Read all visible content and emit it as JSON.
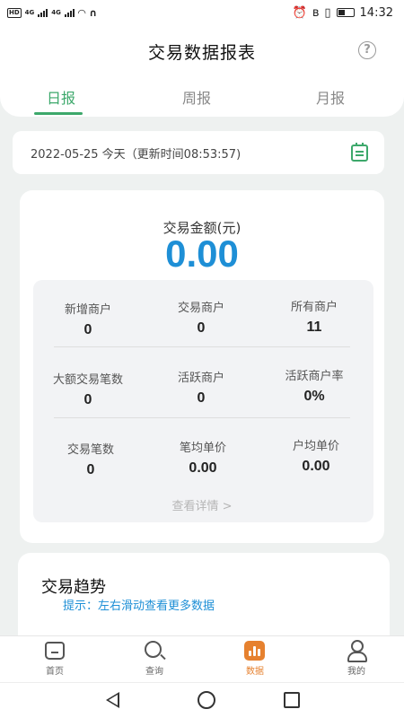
{
  "status_bar": {
    "hd1": "HD",
    "hd2": "HD",
    "net1": "4G",
    "net2": "4G",
    "battery_level": 0.45,
    "time": "14:32"
  },
  "header": {
    "title": "交易数据报表",
    "help_glyph": "?"
  },
  "tabs": [
    {
      "label": "日报",
      "active": true
    },
    {
      "label": "周报",
      "active": false
    },
    {
      "label": "月报",
      "active": false
    }
  ],
  "date_bar": {
    "text": "2022-05-25 今天（更新时间08:53:57)"
  },
  "summary": {
    "amount_label": "交易金额(元)",
    "amount_value": "0.00"
  },
  "stats": [
    {
      "label": "新增商户",
      "value": "0"
    },
    {
      "label": "交易商户",
      "value": "0"
    },
    {
      "label": "所有商户",
      "value": "11"
    },
    {
      "label": "大额交易笔数",
      "value": "0"
    },
    {
      "label": "活跃商户",
      "value": "0"
    },
    {
      "label": "活跃商户率",
      "value": "0%"
    },
    {
      "label": "交易笔数",
      "value": "0"
    },
    {
      "label": "笔均单价",
      "value": "0.00"
    },
    {
      "label": "户均单价",
      "value": "0.00"
    }
  ],
  "detail_link": "查看详情 >",
  "trend": {
    "title": "交易趋势",
    "hint": "提示：左右滑动查看更多数据"
  },
  "bottom_nav": [
    {
      "label": "首页",
      "icon": "home-icon",
      "active": false
    },
    {
      "label": "查询",
      "icon": "search-icon",
      "active": false
    },
    {
      "label": "数据",
      "icon": "data-chart-icon",
      "active": true
    },
    {
      "label": "我的",
      "icon": "user-icon",
      "active": false
    }
  ],
  "colors": {
    "accent_green": "#3da86b",
    "amount_blue": "#1e8fd6",
    "nav_active_orange": "#e6812f"
  }
}
